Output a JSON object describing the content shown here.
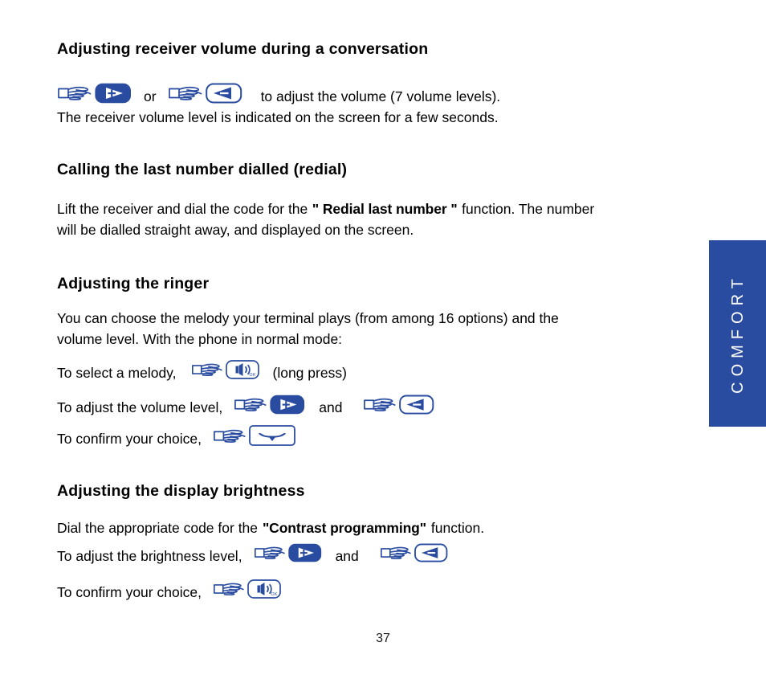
{
  "document": {
    "page_number": "37",
    "side_tab_label": "COMFORT",
    "accent_color": "#2A4CA0",
    "text_color": "#000000"
  },
  "sections": [
    {
      "heading": "Adjusting receiver volume during a conversation",
      "lines": [
        {
          "parts": [
            {
              "type": "icon",
              "name": "hand-pointer-icon"
            },
            {
              "type": "icon",
              "name": "volume-up-key-icon"
            },
            {
              "type": "text",
              "value": "or"
            },
            {
              "type": "icon",
              "name": "hand-pointer-icon"
            },
            {
              "type": "icon",
              "name": "volume-down-key-icon"
            },
            {
              "type": "text",
              "value": "to adjust the volume (7 volume levels)."
            }
          ]
        },
        {
          "parts": [
            {
              "type": "text",
              "value": "The receiver volume level is indicated on the screen for a few seconds."
            }
          ]
        }
      ]
    },
    {
      "heading": "Calling the last number dialled (redial)",
      "lines": [
        {
          "parts": [
            {
              "type": "text",
              "value": "Lift the receiver and dial the code for the "
            },
            {
              "type": "bold",
              "value": "\" Redial last number \""
            },
            {
              "type": "text",
              "value": " function. The number"
            }
          ]
        },
        {
          "parts": [
            {
              "type": "text",
              "value": "will be dialled straight away, and displayed on the screen."
            }
          ]
        }
      ]
    },
    {
      "heading": "Adjusting the ringer",
      "lines": [
        {
          "parts": [
            {
              "type": "text",
              "value": "You can choose the melody your terminal plays (from among 16 options) and the"
            }
          ]
        },
        {
          "parts": [
            {
              "type": "text",
              "value": "volume level.  With the phone in normal mode:"
            }
          ]
        },
        {
          "parts": [
            {
              "type": "text",
              "value": "To select a melody,"
            },
            {
              "type": "icon",
              "name": "hand-pointer-icon"
            },
            {
              "type": "icon",
              "name": "speaker-ok-key-icon"
            },
            {
              "type": "text",
              "value": "(long press)"
            }
          ]
        },
        {
          "parts": [
            {
              "type": "text",
              "value": "To adjust the volume level,"
            },
            {
              "type": "icon",
              "name": "hand-pointer-icon"
            },
            {
              "type": "icon",
              "name": "volume-up-key-icon"
            },
            {
              "type": "text",
              "value": "and"
            },
            {
              "type": "icon",
              "name": "hand-pointer-icon"
            },
            {
              "type": "icon",
              "name": "volume-down-key-icon"
            }
          ]
        },
        {
          "parts": [
            {
              "type": "text",
              "value": "To confirm your choice,"
            },
            {
              "type": "icon",
              "name": "hand-pointer-icon"
            },
            {
              "type": "icon",
              "name": "hangup-key-icon"
            }
          ]
        }
      ]
    },
    {
      "heading": "Adjusting the display brightness",
      "lines": [
        {
          "parts": [
            {
              "type": "text",
              "value": "Dial the appropriate code for the "
            },
            {
              "type": "bold",
              "value": "\"Contrast programming\""
            },
            {
              "type": "text",
              "value": " function."
            }
          ]
        },
        {
          "parts": [
            {
              "type": "text",
              "value": "To adjust the brightness level,"
            },
            {
              "type": "icon",
              "name": "hand-pointer-icon"
            },
            {
              "type": "icon",
              "name": "volume-up-key-icon"
            },
            {
              "type": "text",
              "value": "and"
            },
            {
              "type": "icon",
              "name": "hand-pointer-icon"
            },
            {
              "type": "icon",
              "name": "volume-down-key-icon"
            }
          ]
        },
        {
          "parts": [
            {
              "type": "text",
              "value": "To confirm your choice,"
            },
            {
              "type": "icon",
              "name": "hand-pointer-icon"
            },
            {
              "type": "icon",
              "name": "speaker-ok-key-icon"
            }
          ]
        }
      ]
    }
  ],
  "text": {
    "s1_heading": "Adjusting receiver volume during a conversation",
    "s1_or": "or",
    "s1_tail": "to adjust the volume (7 volume levels).",
    "s1_line2": "The receiver volume level is indicated on the screen for a few seconds.",
    "s2_heading": "Calling the last number dialled (redial)",
    "s2_line1_a": "Lift the receiver and dial the code for the",
    "s2_line1_bold": "\" Redial last number \"",
    "s2_line1_b": "function. The number",
    "s2_line2": "will be dialled straight away, and displayed on the screen.",
    "s3_heading": "Adjusting the ringer",
    "s3_line1": "You can choose the melody your terminal plays (from among 16 options) and the",
    "s3_line2": "volume level.  With the phone in normal mode:",
    "s3_line3_a": "To select a melody,",
    "s3_line3_b": "(long press)",
    "s3_line4_a": "To adjust the volume level,",
    "s3_line4_and": "and",
    "s3_line5_a": "To confirm your choice,",
    "s4_heading": "Adjusting the display brightness",
    "s4_line1_a": "Dial the appropriate code for the",
    "s4_line1_bold": "\"Contrast programming\"",
    "s4_line1_b": "function.",
    "s4_line2_a": "To adjust the brightness level,",
    "s4_line2_and": "and",
    "s4_line3_a": "To confirm your choice,",
    "icon_names": {
      "hand": "hand-pointer-icon",
      "vol_up": "volume-up-key-icon",
      "vol_down": "volume-down-key-icon",
      "speaker_ok": "speaker-ok-key-icon",
      "hangup": "hangup-key-icon"
    },
    "speaker_ok_sublabel": "OK"
  }
}
